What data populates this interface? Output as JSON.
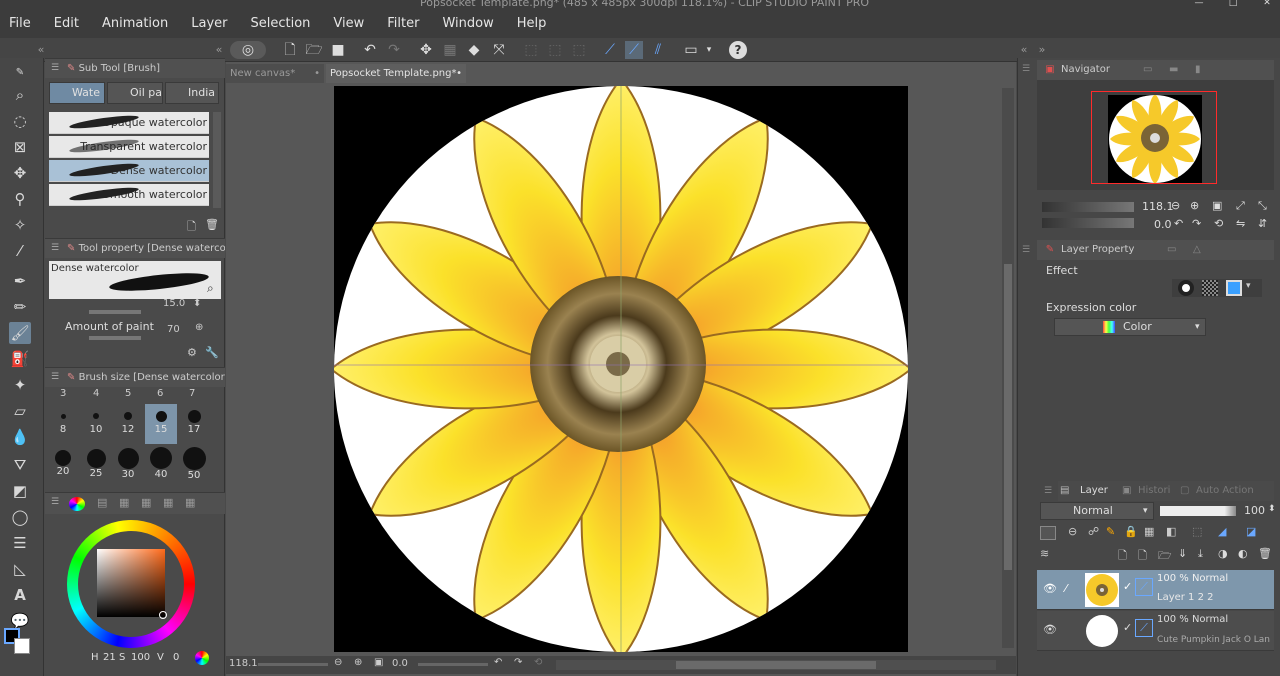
{
  "window": {
    "title": "Popsocket Template.png* (485 x 485px 300dpi 118.1%) - CLIP STUDIO PAINT PRO"
  },
  "menu": [
    "File",
    "Edit",
    "Animation",
    "Layer",
    "Selection",
    "View",
    "Filter",
    "Window",
    "Help"
  ],
  "subtool": {
    "header": "Sub Tool [Brush]",
    "tabs": [
      "Wate",
      "Oil pa",
      "India"
    ],
    "brushes": [
      "Opaque watercolor",
      "Transparent watercolor",
      "Dense watercolor",
      "Smooth watercolor"
    ],
    "selected_brush": "Dense watercolor"
  },
  "toolprop": {
    "header": "Tool property [Dense waterco",
    "preview_label": "Dense watercolor",
    "brush_size_value": "15.0",
    "amount_label": "Amount of paint",
    "amount_value": "70"
  },
  "brushsize": {
    "header": "Brush size [Dense watercolor]",
    "top_labels": [
      "3",
      "4",
      "5",
      "6",
      "7"
    ],
    "sizes": [
      "8",
      "10",
      "12",
      "15",
      "17",
      "20",
      "25",
      "30",
      "40",
      "50"
    ],
    "selected": "15"
  },
  "colorbar": {
    "h_label": "H",
    "h_value": "21",
    "s_label": "S",
    "s_value": "100",
    "v_label": "V",
    "v_value": "0"
  },
  "doctabs": [
    "New canvas*",
    "Popsocket Template.png*"
  ],
  "status": {
    "zoom": "118.1",
    "rotate": "0.0"
  },
  "navigator": {
    "header": "Navigator",
    "zoom": "118.1",
    "angle": "0.0"
  },
  "layerprop": {
    "header": "Layer Property",
    "effect_label": "Effect",
    "expression_label": "Expression color",
    "expression_value": "Color"
  },
  "layers": {
    "tabs": [
      "Layer",
      "Histori",
      "Auto Action"
    ],
    "blend_mode": "Normal",
    "opacity": "100",
    "rows": [
      {
        "mode": "100 % Normal",
        "name": "Layer 1 2 2"
      },
      {
        "mode": "100 % Normal",
        "name": "Cute Pumpkin Jack O Lan"
      }
    ]
  },
  "colors": {
    "accent": "#6f8aa3",
    "nav_frame": "#ff2b2b"
  }
}
